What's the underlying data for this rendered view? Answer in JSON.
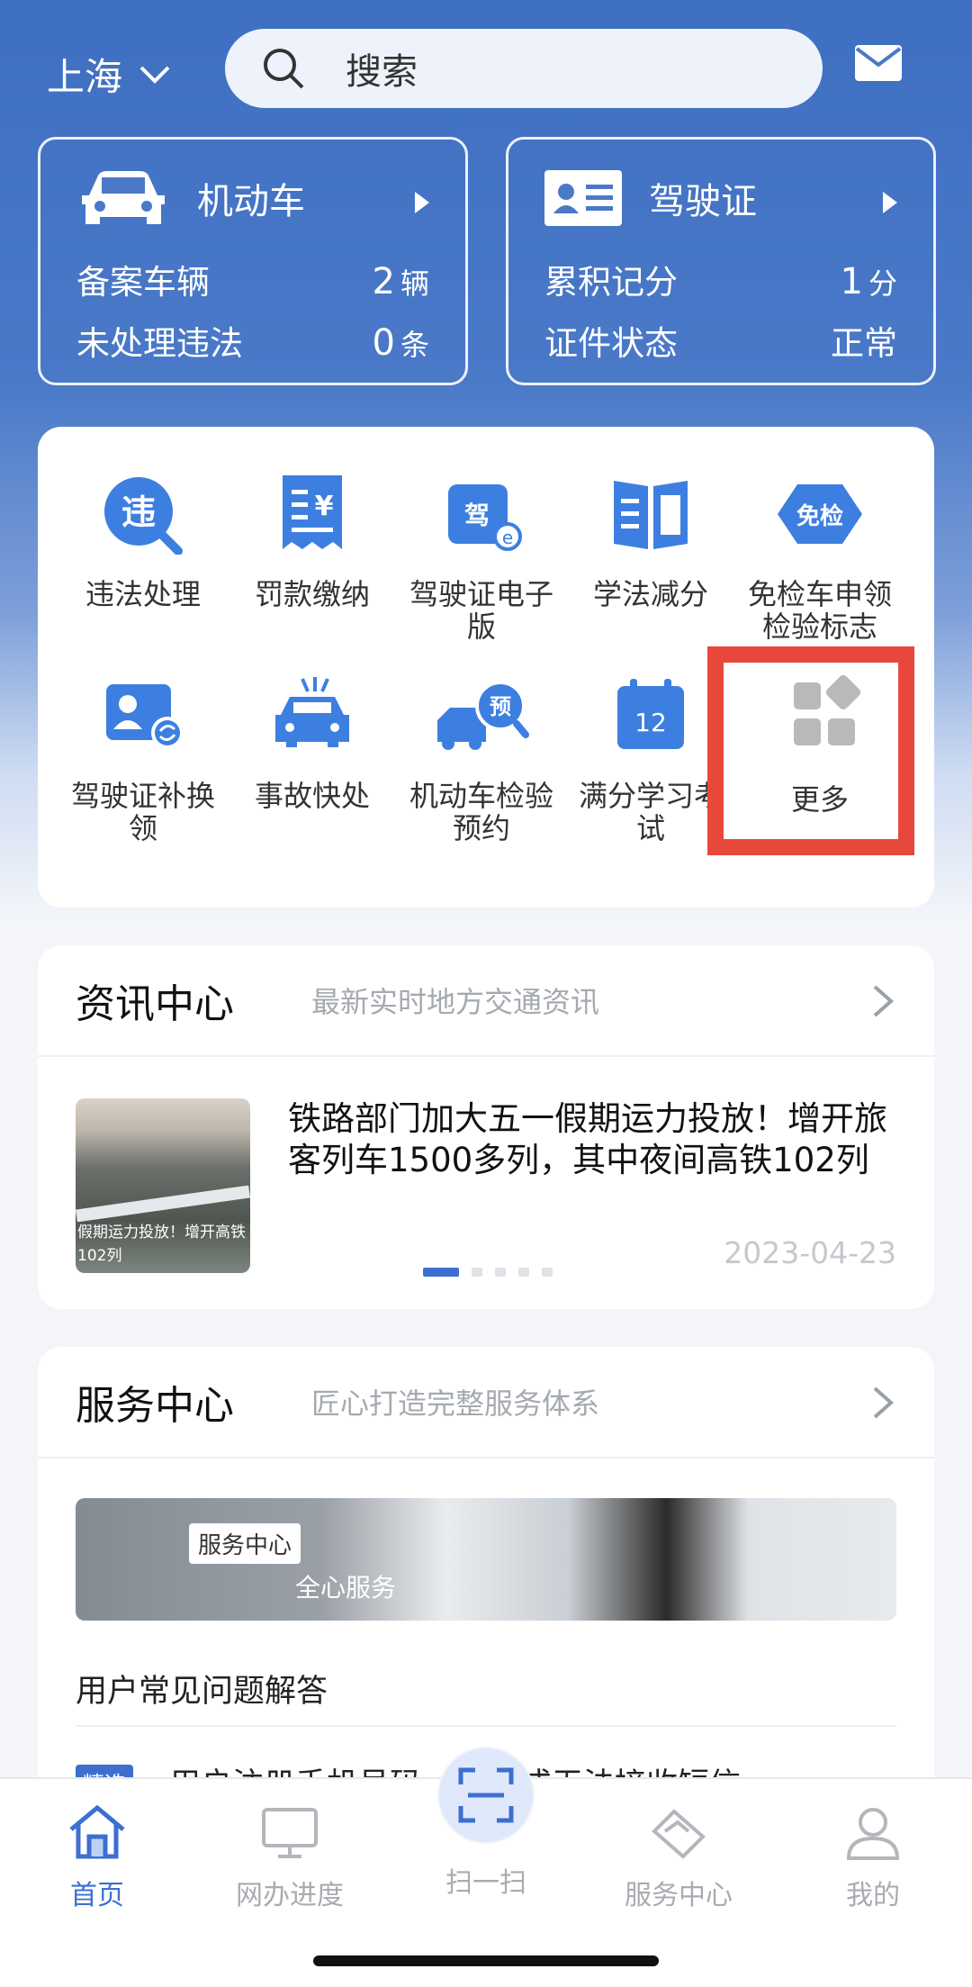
{
  "header": {
    "city": "上海",
    "search_placeholder": "搜索"
  },
  "vehicle_card": {
    "title": "机动车",
    "rows": [
      {
        "label": "备案车辆",
        "value": "2",
        "unit": "辆"
      },
      {
        "label": "未处理违法",
        "value": "0",
        "unit": "条"
      }
    ]
  },
  "license_card": {
    "title": "驾驶证",
    "rows": [
      {
        "label": "累积记分",
        "value": "1",
        "unit": "分"
      },
      {
        "label": "证件状态",
        "value": "正常",
        "unit": ""
      }
    ]
  },
  "services": [
    {
      "label": "违法处理",
      "icon": "violation-search-icon"
    },
    {
      "label": "罚款缴纳",
      "icon": "fine-receipt-icon"
    },
    {
      "label": "驾驶证电子版",
      "icon": "e-license-icon"
    },
    {
      "label": "学法减分",
      "icon": "book-icon"
    },
    {
      "label": "免检车申领检验标志",
      "icon": "exempt-badge-icon",
      "badge": "免检"
    },
    {
      "label": "驾驶证补换领",
      "icon": "license-renew-icon"
    },
    {
      "label": "事故快处",
      "icon": "car-accident-icon"
    },
    {
      "label": "机动车检验预约",
      "icon": "inspection-booking-icon",
      "badge": "预"
    },
    {
      "label": "满分学习考试",
      "icon": "calendar-12-icon",
      "badge": "12"
    },
    {
      "label": "更多",
      "icon": "more-grid-icon"
    }
  ],
  "news": {
    "title": "资讯中心",
    "subtitle": "最新实时地方交通资讯",
    "headline": "铁路部门加大五一假期运力投放！增开旅客列车1500多列，其中夜间高铁102列",
    "image_caption": "假期运力投放！增开高铁102列",
    "date": "2023-04-23"
  },
  "service_center": {
    "title": "服务中心",
    "subtitle": "匠心打造完整服务体系",
    "banner_tag": "服务中心",
    "banner_text": "全心服务",
    "faq_title": "用户常见问题解答",
    "featured_tag": "精选",
    "faq_item_a": "用户注册手机号码",
    "faq_item_b": "注销或无法接收短信"
  },
  "tabbar": [
    {
      "label": "首页",
      "icon": "home-icon"
    },
    {
      "label": "网办进度",
      "icon": "monitor-icon"
    },
    {
      "label": "扫一扫",
      "icon": "scan-icon"
    },
    {
      "label": "服务中心",
      "icon": "handshake-icon"
    },
    {
      "label": "我的",
      "icon": "user-icon"
    }
  ],
  "colors": {
    "accent": "#3d6fd0",
    "header_blue": "#4a79c8",
    "highlight_red": "#e8483c"
  }
}
